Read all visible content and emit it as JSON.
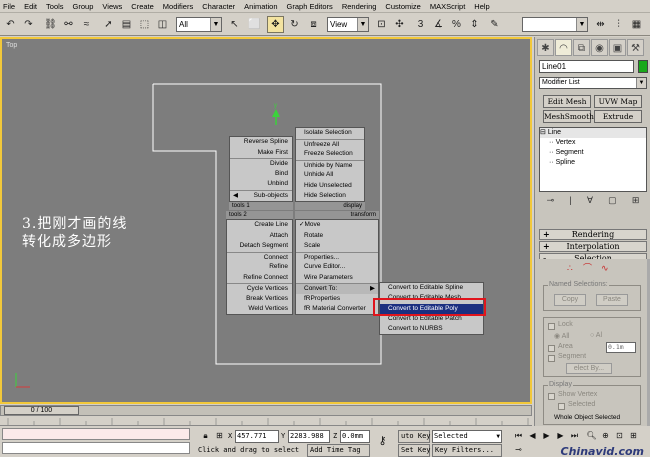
{
  "menu": [
    "File",
    "Edit",
    "Tools",
    "Group",
    "Views",
    "Create",
    "Modifiers",
    "Character",
    "Animation",
    "Graph Editors",
    "Rendering",
    "Customize",
    "MAXScript",
    "Help"
  ],
  "toolbar": {
    "selection_filter": "All",
    "ref_coord": "View"
  },
  "viewport": {
    "label": "Top",
    "gizmo_axis": "y",
    "caption_line1": "3.把刚才画的线",
    "caption_line2": "转化成多边形"
  },
  "quad_menu": {
    "left_top_items": [
      "Reverse Spline",
      "Make First",
      "Divide",
      "Bind",
      "Unbind",
      "Sub-objects"
    ],
    "left_top_title": "tools 1",
    "left_bottom_title": "tools 2",
    "left_bottom_items": [
      "Create Line",
      "Attach",
      "Detach Segment",
      "Connect",
      "Refine",
      "Refine Connect",
      "Cycle Vertices",
      "Break Vertices",
      "Weld Vertices"
    ],
    "right_top_items": [
      "Isolate Selection",
      "Unfreeze All",
      "Freeze Selection",
      "Unhide by Name",
      "Unhide All",
      "Hide Unselected",
      "Hide Selection"
    ],
    "right_top_title": "display",
    "right_bottom_title": "transform",
    "right_bottom_items": [
      "✓Move",
      "Rotate",
      "Scale",
      "Properties...",
      "Curve Editor...",
      "Wire Parameters",
      "Convert To:",
      "fRProperties",
      "fR Material Converter"
    ]
  },
  "convert_submenu": [
    "Convert to Editable Spline",
    "Convert to Editable Mesh",
    "Convert to Editable Poly",
    "Convert to Editable Patch",
    "Convert to NURBS"
  ],
  "convert_submenu_selected_index": 2,
  "time_slider": {
    "label": "0 / 100"
  },
  "status": {
    "x_label": "X",
    "x_value": "457.771",
    "y_label": "Y",
    "y_value": "2283.988",
    "z_label": "Z",
    "z_value": "0.0mm",
    "prompt": "Click and drag to select",
    "add_time_tag": "Add Time Tag",
    "auto_key": "uto Key",
    "set_key": "Set Key",
    "key_mode": "Selected",
    "key_filters": "Key Filters..."
  },
  "watermark": "Chinavid.com",
  "command_panel": {
    "object_name": "Line01",
    "object_color": "#1aa81a",
    "modifier_list": "Modifier List",
    "buttons": [
      "Edit Mesh",
      "UVW Map",
      "MeshSmooth",
      "Extrude"
    ],
    "stack": [
      "Line",
      "Vertex",
      "Segment",
      "Spline"
    ],
    "rollouts": [
      {
        "sign": "+",
        "label": "Rendering"
      },
      {
        "sign": "+",
        "label": "Interpolation"
      },
      {
        "sign": "-",
        "label": "Selection"
      }
    ],
    "named_selections": {
      "title": "Named Selections:",
      "copy": "Copy",
      "paste": "Paste"
    },
    "lock_label": "Lock",
    "lock_value": "0.1m",
    "all_label": "All",
    "alt_label": "Al",
    "area_label": "Area",
    "segment_label": "Segment",
    "select_by": "elect By...",
    "display_title": "Display",
    "show_vertex": "Show Vertex",
    "selected_label": "Selected",
    "whole_object": "Whole Object Selected"
  }
}
